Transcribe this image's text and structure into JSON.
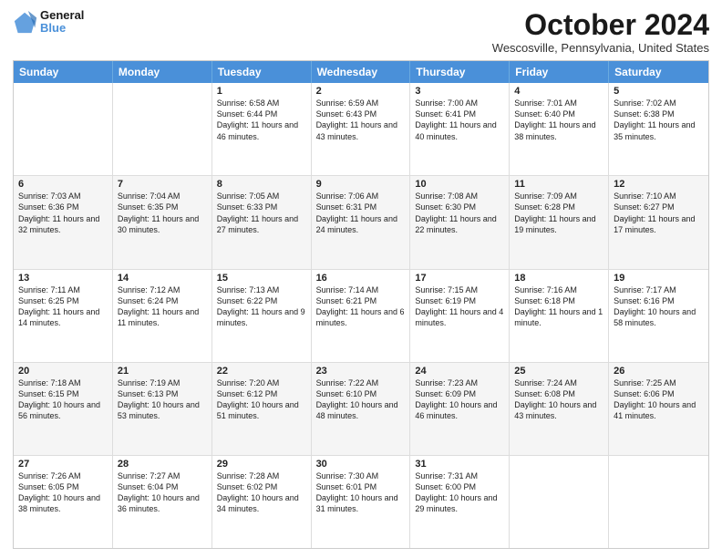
{
  "header": {
    "logo_line1": "General",
    "logo_line2": "Blue",
    "title": "October 2024",
    "subtitle": "Wescosville, Pennsylvania, United States"
  },
  "days_of_week": [
    "Sunday",
    "Monday",
    "Tuesday",
    "Wednesday",
    "Thursday",
    "Friday",
    "Saturday"
  ],
  "weeks": [
    {
      "alt": false,
      "cells": [
        {
          "day": "",
          "sunrise": "",
          "sunset": "",
          "daylight": ""
        },
        {
          "day": "",
          "sunrise": "",
          "sunset": "",
          "daylight": ""
        },
        {
          "day": "1",
          "sunrise": "Sunrise: 6:58 AM",
          "sunset": "Sunset: 6:44 PM",
          "daylight": "Daylight: 11 hours and 46 minutes."
        },
        {
          "day": "2",
          "sunrise": "Sunrise: 6:59 AM",
          "sunset": "Sunset: 6:43 PM",
          "daylight": "Daylight: 11 hours and 43 minutes."
        },
        {
          "day": "3",
          "sunrise": "Sunrise: 7:00 AM",
          "sunset": "Sunset: 6:41 PM",
          "daylight": "Daylight: 11 hours and 40 minutes."
        },
        {
          "day": "4",
          "sunrise": "Sunrise: 7:01 AM",
          "sunset": "Sunset: 6:40 PM",
          "daylight": "Daylight: 11 hours and 38 minutes."
        },
        {
          "day": "5",
          "sunrise": "Sunrise: 7:02 AM",
          "sunset": "Sunset: 6:38 PM",
          "daylight": "Daylight: 11 hours and 35 minutes."
        }
      ]
    },
    {
      "alt": true,
      "cells": [
        {
          "day": "6",
          "sunrise": "Sunrise: 7:03 AM",
          "sunset": "Sunset: 6:36 PM",
          "daylight": "Daylight: 11 hours and 32 minutes."
        },
        {
          "day": "7",
          "sunrise": "Sunrise: 7:04 AM",
          "sunset": "Sunset: 6:35 PM",
          "daylight": "Daylight: 11 hours and 30 minutes."
        },
        {
          "day": "8",
          "sunrise": "Sunrise: 7:05 AM",
          "sunset": "Sunset: 6:33 PM",
          "daylight": "Daylight: 11 hours and 27 minutes."
        },
        {
          "day": "9",
          "sunrise": "Sunrise: 7:06 AM",
          "sunset": "Sunset: 6:31 PM",
          "daylight": "Daylight: 11 hours and 24 minutes."
        },
        {
          "day": "10",
          "sunrise": "Sunrise: 7:08 AM",
          "sunset": "Sunset: 6:30 PM",
          "daylight": "Daylight: 11 hours and 22 minutes."
        },
        {
          "day": "11",
          "sunrise": "Sunrise: 7:09 AM",
          "sunset": "Sunset: 6:28 PM",
          "daylight": "Daylight: 11 hours and 19 minutes."
        },
        {
          "day": "12",
          "sunrise": "Sunrise: 7:10 AM",
          "sunset": "Sunset: 6:27 PM",
          "daylight": "Daylight: 11 hours and 17 minutes."
        }
      ]
    },
    {
      "alt": false,
      "cells": [
        {
          "day": "13",
          "sunrise": "Sunrise: 7:11 AM",
          "sunset": "Sunset: 6:25 PM",
          "daylight": "Daylight: 11 hours and 14 minutes."
        },
        {
          "day": "14",
          "sunrise": "Sunrise: 7:12 AM",
          "sunset": "Sunset: 6:24 PM",
          "daylight": "Daylight: 11 hours and 11 minutes."
        },
        {
          "day": "15",
          "sunrise": "Sunrise: 7:13 AM",
          "sunset": "Sunset: 6:22 PM",
          "daylight": "Daylight: 11 hours and 9 minutes."
        },
        {
          "day": "16",
          "sunrise": "Sunrise: 7:14 AM",
          "sunset": "Sunset: 6:21 PM",
          "daylight": "Daylight: 11 hours and 6 minutes."
        },
        {
          "day": "17",
          "sunrise": "Sunrise: 7:15 AM",
          "sunset": "Sunset: 6:19 PM",
          "daylight": "Daylight: 11 hours and 4 minutes."
        },
        {
          "day": "18",
          "sunrise": "Sunrise: 7:16 AM",
          "sunset": "Sunset: 6:18 PM",
          "daylight": "Daylight: 11 hours and 1 minute."
        },
        {
          "day": "19",
          "sunrise": "Sunrise: 7:17 AM",
          "sunset": "Sunset: 6:16 PM",
          "daylight": "Daylight: 10 hours and 58 minutes."
        }
      ]
    },
    {
      "alt": true,
      "cells": [
        {
          "day": "20",
          "sunrise": "Sunrise: 7:18 AM",
          "sunset": "Sunset: 6:15 PM",
          "daylight": "Daylight: 10 hours and 56 minutes."
        },
        {
          "day": "21",
          "sunrise": "Sunrise: 7:19 AM",
          "sunset": "Sunset: 6:13 PM",
          "daylight": "Daylight: 10 hours and 53 minutes."
        },
        {
          "day": "22",
          "sunrise": "Sunrise: 7:20 AM",
          "sunset": "Sunset: 6:12 PM",
          "daylight": "Daylight: 10 hours and 51 minutes."
        },
        {
          "day": "23",
          "sunrise": "Sunrise: 7:22 AM",
          "sunset": "Sunset: 6:10 PM",
          "daylight": "Daylight: 10 hours and 48 minutes."
        },
        {
          "day": "24",
          "sunrise": "Sunrise: 7:23 AM",
          "sunset": "Sunset: 6:09 PM",
          "daylight": "Daylight: 10 hours and 46 minutes."
        },
        {
          "day": "25",
          "sunrise": "Sunrise: 7:24 AM",
          "sunset": "Sunset: 6:08 PM",
          "daylight": "Daylight: 10 hours and 43 minutes."
        },
        {
          "day": "26",
          "sunrise": "Sunrise: 7:25 AM",
          "sunset": "Sunset: 6:06 PM",
          "daylight": "Daylight: 10 hours and 41 minutes."
        }
      ]
    },
    {
      "alt": false,
      "cells": [
        {
          "day": "27",
          "sunrise": "Sunrise: 7:26 AM",
          "sunset": "Sunset: 6:05 PM",
          "daylight": "Daylight: 10 hours and 38 minutes."
        },
        {
          "day": "28",
          "sunrise": "Sunrise: 7:27 AM",
          "sunset": "Sunset: 6:04 PM",
          "daylight": "Daylight: 10 hours and 36 minutes."
        },
        {
          "day": "29",
          "sunrise": "Sunrise: 7:28 AM",
          "sunset": "Sunset: 6:02 PM",
          "daylight": "Daylight: 10 hours and 34 minutes."
        },
        {
          "day": "30",
          "sunrise": "Sunrise: 7:30 AM",
          "sunset": "Sunset: 6:01 PM",
          "daylight": "Daylight: 10 hours and 31 minutes."
        },
        {
          "day": "31",
          "sunrise": "Sunrise: 7:31 AM",
          "sunset": "Sunset: 6:00 PM",
          "daylight": "Daylight: 10 hours and 29 minutes."
        },
        {
          "day": "",
          "sunrise": "",
          "sunset": "",
          "daylight": ""
        },
        {
          "day": "",
          "sunrise": "",
          "sunset": "",
          "daylight": ""
        }
      ]
    }
  ]
}
